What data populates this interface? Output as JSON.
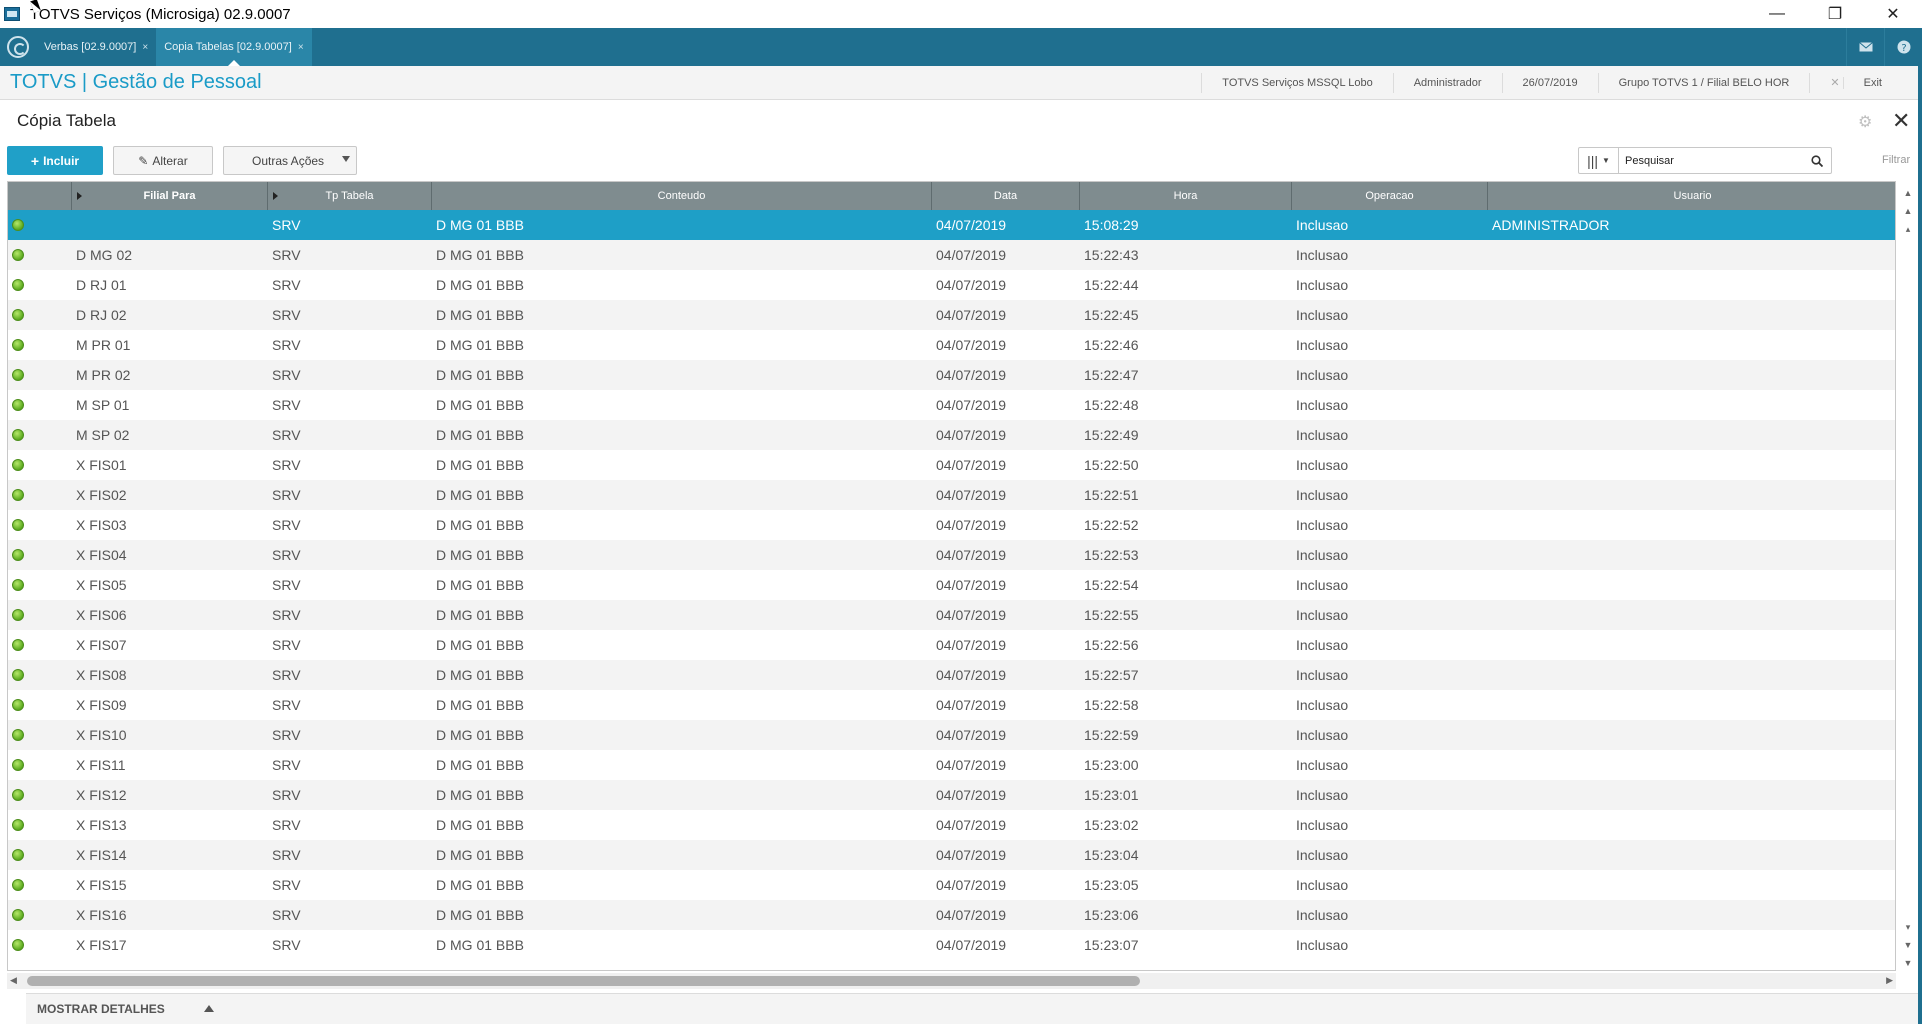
{
  "window": {
    "title": "TOTVS Serviços (Microsiga) 02.9.0007",
    "minimize": "—",
    "maximize": "❐",
    "close": "✕"
  },
  "tabs": [
    {
      "label": "Verbas [02.9.0007]",
      "close": "×"
    },
    {
      "label": "Copia Tabelas [02.9.0007]",
      "close": "×"
    }
  ],
  "header": {
    "brand": "TOTVS | Gestão de Pessoal",
    "environment": "TOTVS Serviços MSSQL Lobo",
    "user": "Administrador",
    "date": "26/07/2019",
    "group": "Grupo TOTVS 1 / Filial BELO HOR",
    "exit": "Exit"
  },
  "page": {
    "title": "Cópia Tabela"
  },
  "toolbar": {
    "incluir": "Incluir",
    "alterar": "Alterar",
    "outras": "Outras Ações",
    "search_placeholder": "Pesquisar",
    "filtrar": "Filtrar"
  },
  "grid": {
    "columns": [
      "",
      "Filial Para",
      "Tp Tabela",
      "Conteudo",
      "Data",
      "Hora",
      "Operacao",
      "Usuario"
    ],
    "rows": [
      {
        "filial": "",
        "tp": "SRV",
        "conteudo": "D MG 01 BBB",
        "data": "04/07/2019",
        "hora": "15:08:29",
        "operacao": "Inclusao",
        "usuario": "ADMINISTRADOR"
      },
      {
        "filial": "D MG 02",
        "tp": "SRV",
        "conteudo": "D MG 01 BBB",
        "data": "04/07/2019",
        "hora": "15:22:43",
        "operacao": "Inclusao",
        "usuario": ""
      },
      {
        "filial": "D RJ 01",
        "tp": "SRV",
        "conteudo": "D MG 01 BBB",
        "data": "04/07/2019",
        "hora": "15:22:44",
        "operacao": "Inclusao",
        "usuario": ""
      },
      {
        "filial": "D RJ 02",
        "tp": "SRV",
        "conteudo": "D MG 01 BBB",
        "data": "04/07/2019",
        "hora": "15:22:45",
        "operacao": "Inclusao",
        "usuario": ""
      },
      {
        "filial": "M PR 01",
        "tp": "SRV",
        "conteudo": "D MG 01 BBB",
        "data": "04/07/2019",
        "hora": "15:22:46",
        "operacao": "Inclusao",
        "usuario": ""
      },
      {
        "filial": "M PR 02",
        "tp": "SRV",
        "conteudo": "D MG 01 BBB",
        "data": "04/07/2019",
        "hora": "15:22:47",
        "operacao": "Inclusao",
        "usuario": ""
      },
      {
        "filial": "M SP 01",
        "tp": "SRV",
        "conteudo": "D MG 01 BBB",
        "data": "04/07/2019",
        "hora": "15:22:48",
        "operacao": "Inclusao",
        "usuario": ""
      },
      {
        "filial": "M SP 02",
        "tp": "SRV",
        "conteudo": "D MG 01 BBB",
        "data": "04/07/2019",
        "hora": "15:22:49",
        "operacao": "Inclusao",
        "usuario": ""
      },
      {
        "filial": "X FIS01",
        "tp": "SRV",
        "conteudo": "D MG 01 BBB",
        "data": "04/07/2019",
        "hora": "15:22:50",
        "operacao": "Inclusao",
        "usuario": ""
      },
      {
        "filial": "X FIS02",
        "tp": "SRV",
        "conteudo": "D MG 01 BBB",
        "data": "04/07/2019",
        "hora": "15:22:51",
        "operacao": "Inclusao",
        "usuario": ""
      },
      {
        "filial": "X FIS03",
        "tp": "SRV",
        "conteudo": "D MG 01 BBB",
        "data": "04/07/2019",
        "hora": "15:22:52",
        "operacao": "Inclusao",
        "usuario": ""
      },
      {
        "filial": "X FIS04",
        "tp": "SRV",
        "conteudo": "D MG 01 BBB",
        "data": "04/07/2019",
        "hora": "15:22:53",
        "operacao": "Inclusao",
        "usuario": ""
      },
      {
        "filial": "X FIS05",
        "tp": "SRV",
        "conteudo": "D MG 01 BBB",
        "data": "04/07/2019",
        "hora": "15:22:54",
        "operacao": "Inclusao",
        "usuario": ""
      },
      {
        "filial": "X FIS06",
        "tp": "SRV",
        "conteudo": "D MG 01 BBB",
        "data": "04/07/2019",
        "hora": "15:22:55",
        "operacao": "Inclusao",
        "usuario": ""
      },
      {
        "filial": "X FIS07",
        "tp": "SRV",
        "conteudo": "D MG 01 BBB",
        "data": "04/07/2019",
        "hora": "15:22:56",
        "operacao": "Inclusao",
        "usuario": ""
      },
      {
        "filial": "X FIS08",
        "tp": "SRV",
        "conteudo": "D MG 01 BBB",
        "data": "04/07/2019",
        "hora": "15:22:57",
        "operacao": "Inclusao",
        "usuario": ""
      },
      {
        "filial": "X FIS09",
        "tp": "SRV",
        "conteudo": "D MG 01 BBB",
        "data": "04/07/2019",
        "hora": "15:22:58",
        "operacao": "Inclusao",
        "usuario": ""
      },
      {
        "filial": "X FIS10",
        "tp": "SRV",
        "conteudo": "D MG 01 BBB",
        "data": "04/07/2019",
        "hora": "15:22:59",
        "operacao": "Inclusao",
        "usuario": ""
      },
      {
        "filial": "X FIS11",
        "tp": "SRV",
        "conteudo": "D MG 01 BBB",
        "data": "04/07/2019",
        "hora": "15:23:00",
        "operacao": "Inclusao",
        "usuario": ""
      },
      {
        "filial": "X FIS12",
        "tp": "SRV",
        "conteudo": "D MG 01 BBB",
        "data": "04/07/2019",
        "hora": "15:23:01",
        "operacao": "Inclusao",
        "usuario": ""
      },
      {
        "filial": "X FIS13",
        "tp": "SRV",
        "conteudo": "D MG 01 BBB",
        "data": "04/07/2019",
        "hora": "15:23:02",
        "operacao": "Inclusao",
        "usuario": ""
      },
      {
        "filial": "X FIS14",
        "tp": "SRV",
        "conteudo": "D MG 01 BBB",
        "data": "04/07/2019",
        "hora": "15:23:04",
        "operacao": "Inclusao",
        "usuario": ""
      },
      {
        "filial": "X FIS15",
        "tp": "SRV",
        "conteudo": "D MG 01 BBB",
        "data": "04/07/2019",
        "hora": "15:23:05",
        "operacao": "Inclusao",
        "usuario": ""
      },
      {
        "filial": "X FIS16",
        "tp": "SRV",
        "conteudo": "D MG 01 BBB",
        "data": "04/07/2019",
        "hora": "15:23:06",
        "operacao": "Inclusao",
        "usuario": ""
      },
      {
        "filial": "X FIS17",
        "tp": "SRV",
        "conteudo": "D MG 01 BBB",
        "data": "04/07/2019",
        "hora": "15:23:07",
        "operacao": "Inclusao",
        "usuario": ""
      }
    ],
    "selected_row": 0,
    "status_icon": "green-status-dot-icon"
  },
  "footer": {
    "details_label": "MOSTRAR DETALHES"
  },
  "colors": {
    "accent": "#20a0c8",
    "tabstrip": "#1f6f8f",
    "header_grid": "#7f8c8f",
    "selected_row": "#1e9fc7"
  }
}
